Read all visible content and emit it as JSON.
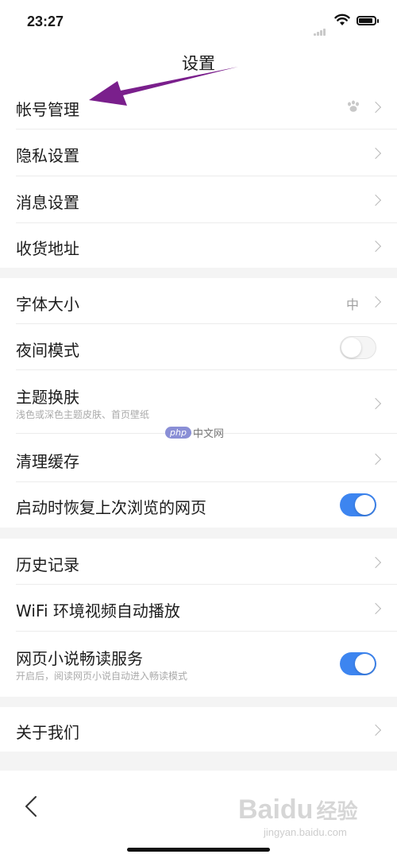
{
  "status_bar": {
    "time": "23:27",
    "battery_level": 0.9
  },
  "header": {
    "title": "设置"
  },
  "sections": [
    {
      "items": [
        {
          "label": "帐号管理",
          "trailing": "chevron",
          "trailing_icon": "paw-avatar-icon"
        },
        {
          "label": "隐私设置",
          "trailing": "chevron"
        },
        {
          "label": "消息设置",
          "trailing": "chevron"
        },
        {
          "label": "收货地址",
          "trailing": "chevron"
        }
      ]
    },
    {
      "items": [
        {
          "label": "字体大小",
          "value": "中",
          "trailing": "chevron"
        },
        {
          "label": "夜间模式",
          "trailing": "toggle",
          "toggle_on": false
        },
        {
          "label": "主题换肤",
          "sublabel": "浅色或深色主题皮肤、首页壁纸",
          "trailing": "chevron"
        },
        {
          "label": "清理缓存",
          "trailing": "chevron"
        },
        {
          "label": "启动时恢复上次浏览的网页",
          "trailing": "toggle",
          "toggle_on": true
        }
      ]
    },
    {
      "items": [
        {
          "label": "历史记录",
          "trailing": "chevron"
        },
        {
          "label": "WiFi 环境视频自动播放",
          "trailing": "chevron"
        },
        {
          "label": "网页小说畅读服务",
          "sublabel": "开启后，阅读网页小说自动进入畅读模式",
          "trailing": "toggle",
          "toggle_on": true
        }
      ]
    },
    {
      "items": [
        {
          "label": "关于我们",
          "trailing": "chevron"
        }
      ]
    }
  ],
  "bottom_bar": {
    "back_icon": "back-chevron-icon"
  },
  "annotation": {
    "arrow_color": "#7a1f8c"
  },
  "colors": {
    "accent": "#3d85f0",
    "separator": "#f4f4f4"
  },
  "watermarks": {
    "php_badge": "php",
    "php_text": "中文网",
    "baidu_logo": "Baidu",
    "baidu_jingyan": "经验",
    "baidu_url": "jingyan.baidu.com"
  }
}
